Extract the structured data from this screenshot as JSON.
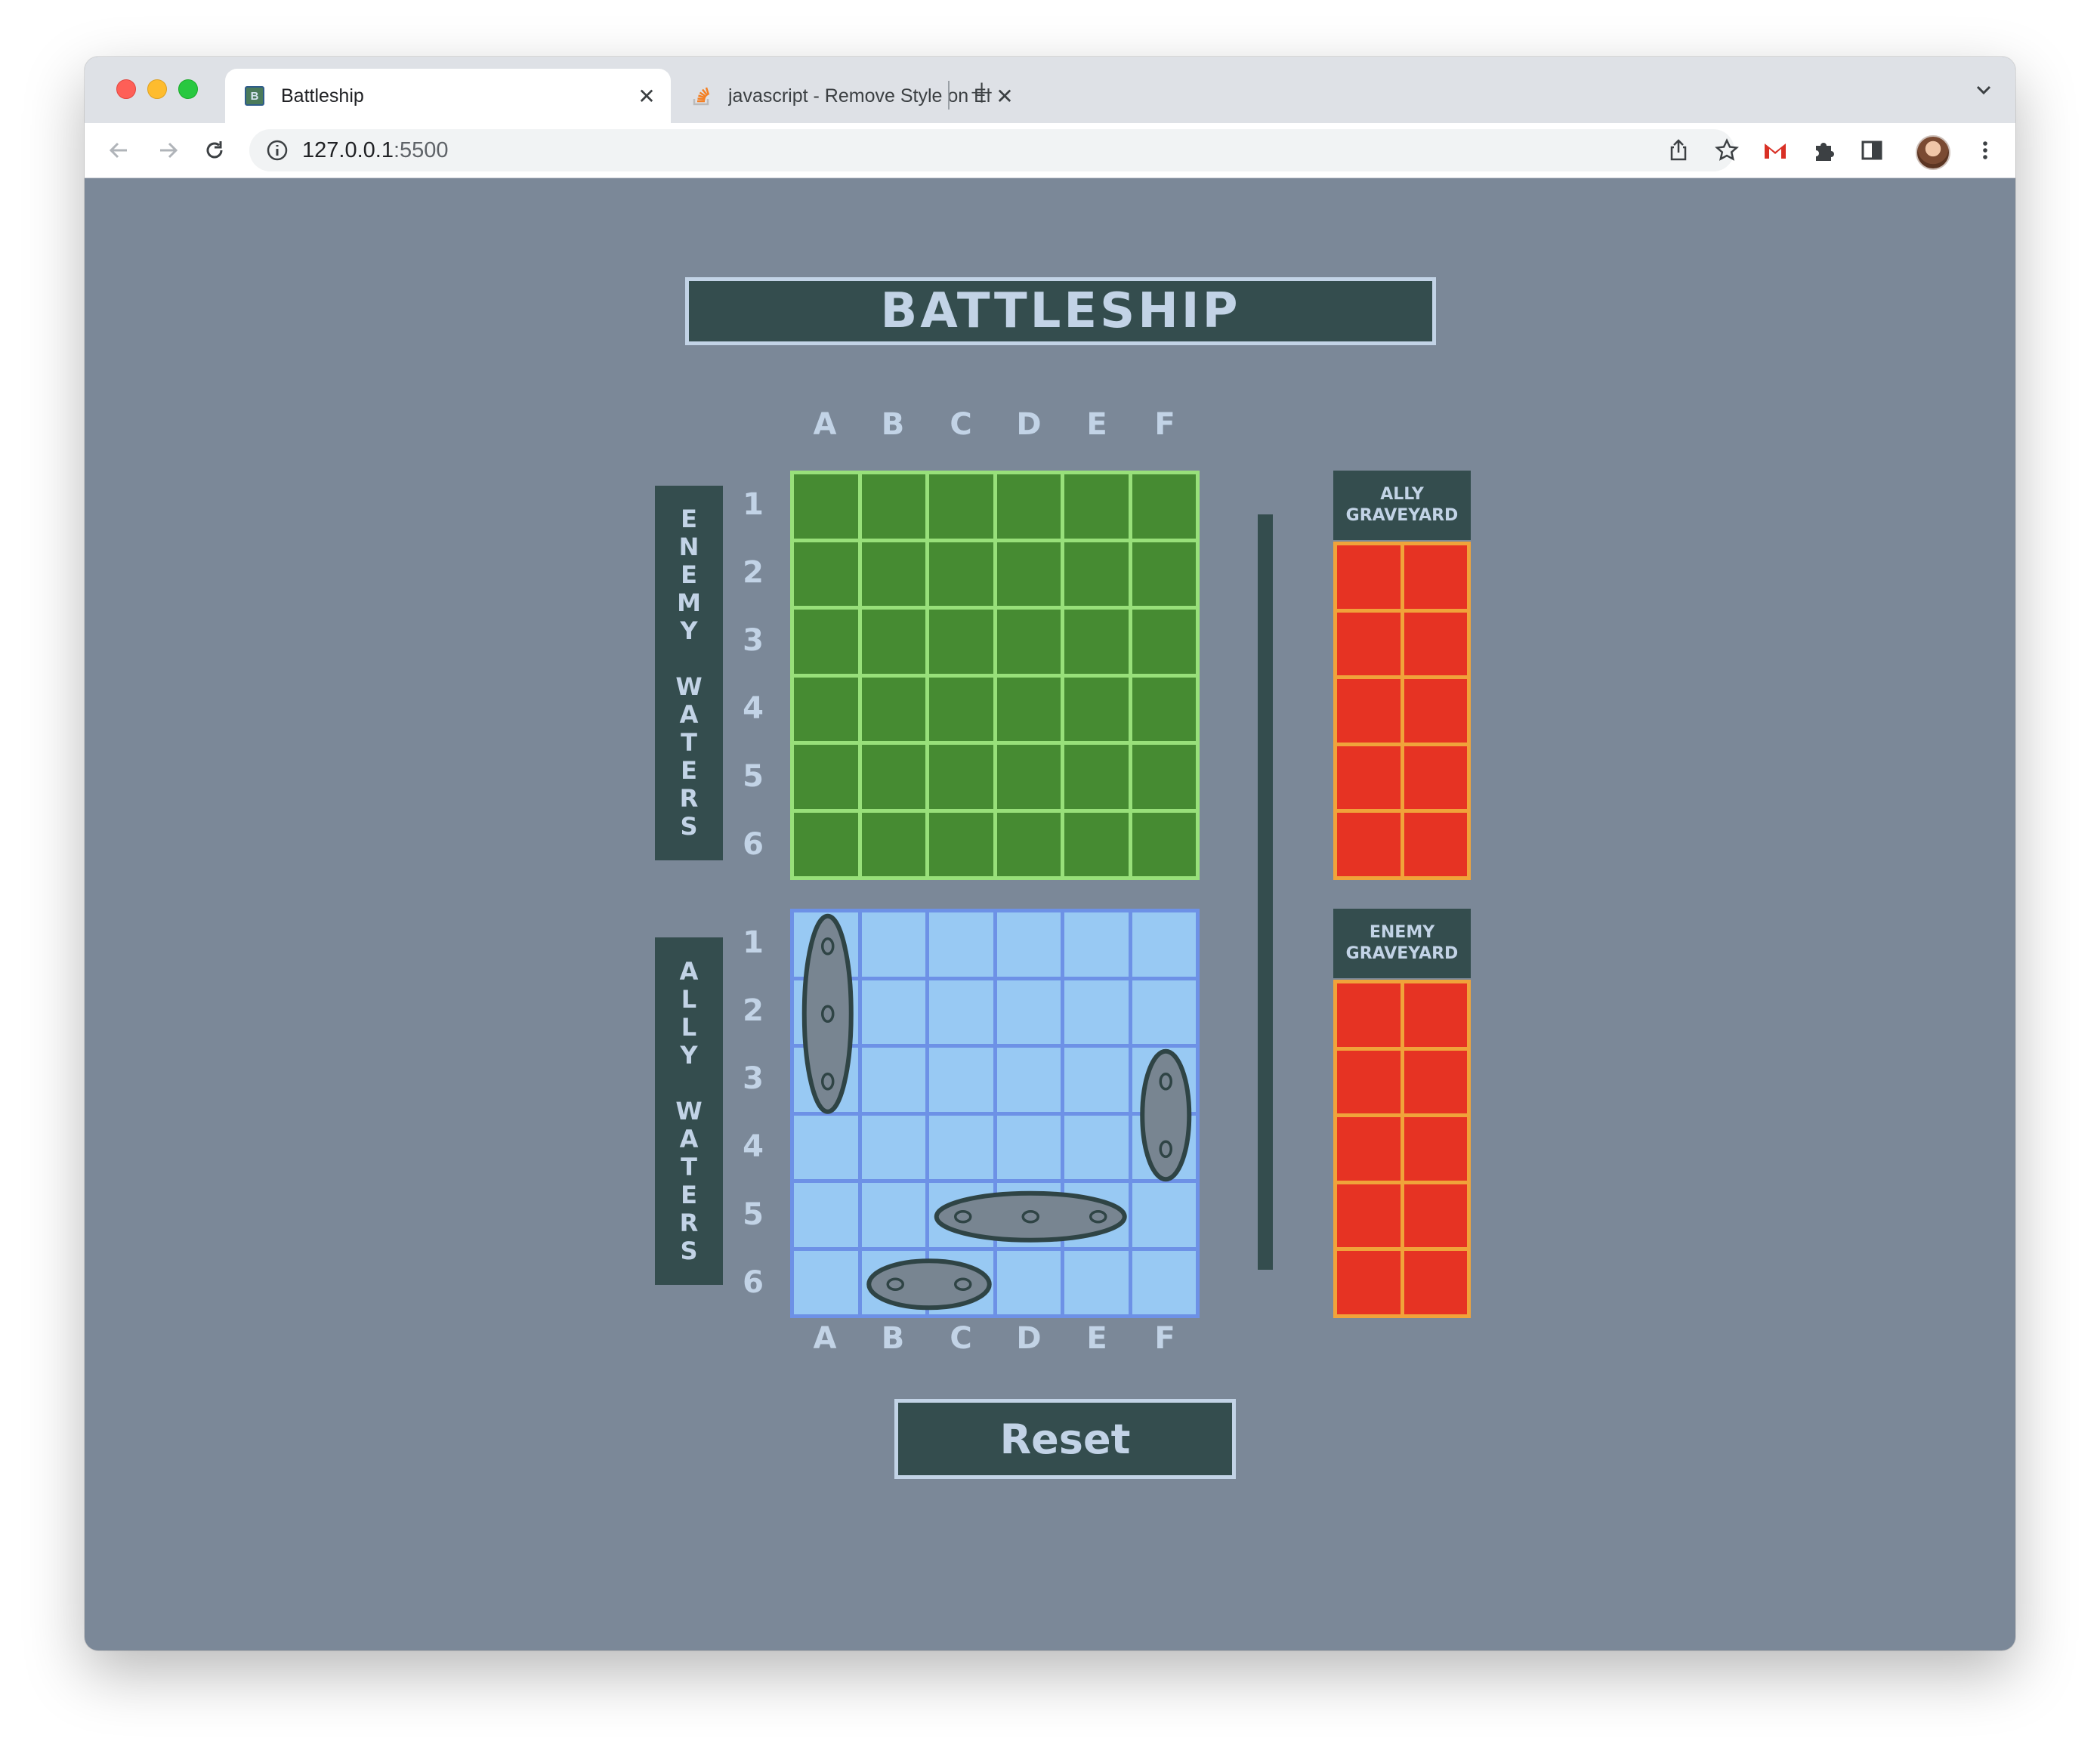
{
  "browser": {
    "tabs": [
      {
        "title": "Battleship",
        "favicon": "B",
        "active": true
      },
      {
        "title": "javascript - Remove Style on El",
        "favicon": "stackoverflow-icon",
        "active": false
      }
    ],
    "close_glyph": "✕",
    "new_tab_glyph": "+",
    "url_host": "127.0.0.1",
    "url_port": ":5500"
  },
  "game": {
    "title": "BATTLESHIP",
    "columns": [
      "A",
      "B",
      "C",
      "D",
      "E",
      "F"
    ],
    "rows": [
      "1",
      "2",
      "3",
      "4",
      "5",
      "6"
    ],
    "enemy_waters_label": "E\nN\nE\nM\nY\n\nW\nA\nT\nE\nR\nS",
    "ally_waters_label": "A\nL\nL\nY\n\nW\nA\nT\nE\nR\nS",
    "ally_graveyard_label": "ALLY\nGRAVEYARD",
    "enemy_graveyard_label": "ENEMY\nGRAVEYARD",
    "reset_label": "Reset",
    "ships": [
      {
        "orientation": "vertical",
        "cells": [
          "A1",
          "A2",
          "A3"
        ]
      },
      {
        "orientation": "vertical",
        "cells": [
          "F3",
          "F4"
        ]
      },
      {
        "orientation": "horizontal",
        "cells": [
          "C5",
          "D5",
          "E5"
        ]
      },
      {
        "orientation": "horizontal",
        "cells": [
          "B6",
          "C6"
        ]
      }
    ],
    "colors": {
      "page_background": "#7b8898",
      "panel": "#344d4e",
      "label_text": "#c2d3e6",
      "enemy_cell": "#468b32",
      "enemy_grid_line": "#98e07a",
      "ally_cell": "#98c9f3",
      "ally_grid_line": "#6d91e6",
      "ship": "#788591",
      "graveyard_cell": "#e63323",
      "graveyard_line": "#f0a33a"
    }
  }
}
